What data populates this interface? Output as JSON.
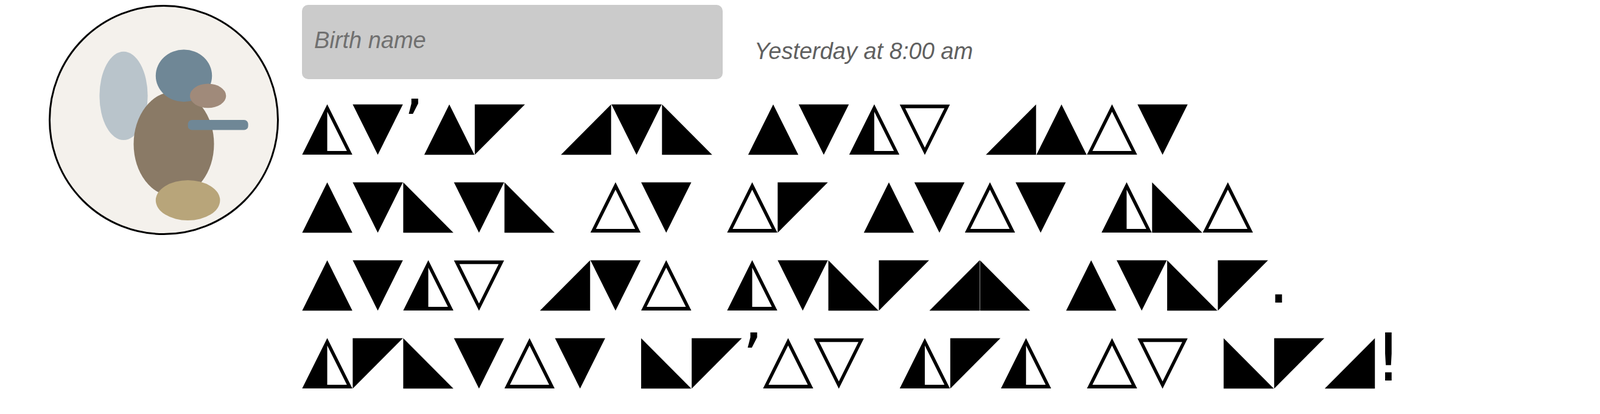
{
  "sender": {
    "name_placeholder": "Birth name"
  },
  "message": {
    "time": "Yesterday at 8:00 am",
    "lines": [
      "◭▼’▲◤ ◢▼◣ ▲▼◭▽ ◢▲△▼",
      "▲▼◣▼◣ △▼ △◤ ▲▼△▼ ◭◣△",
      "▲▼◭▽ ◢▼△ ◭▼◣◤◢◣ ▲▼◣◤.",
      "◭◤◣▼△▼ ◣◤’△▽ ◭◤◭ △▽ ◣◤◢!"
    ]
  }
}
